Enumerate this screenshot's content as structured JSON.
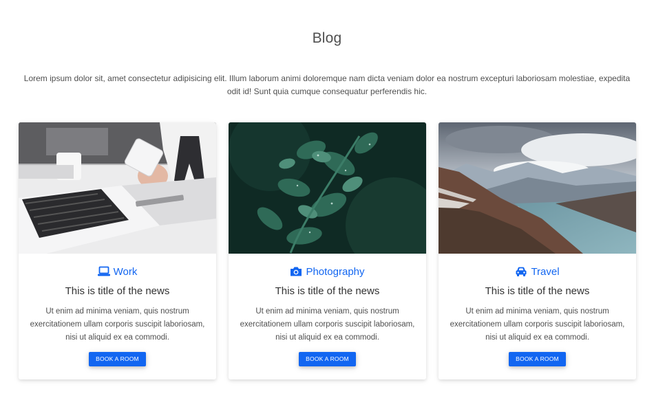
{
  "section": {
    "title": "Blog",
    "intro": "Lorem ipsum dolor sit, amet consectetur adipisicing elit. Illum laborum animi doloremque nam dicta veniam dolor ea nostrum excepturi laboriosam molestiae, expedita odit id! Sunt quia cumque consequatur perferendis hic."
  },
  "colors": {
    "accent": "#1266f1",
    "text": "#4f4f4f"
  },
  "cards": [
    {
      "image": "laptop-phone-desk-photo",
      "category_icon": "laptop-icon",
      "category": "Work",
      "title": "This is title of the news",
      "text": "Ut enim ad minima veniam, quis nostrum exercitationem ullam corporis suscipit laboriosam, nisi ut aliquid ex ea commodi.",
      "button": "Book a room"
    },
    {
      "image": "green-leaves-photo",
      "category_icon": "camera-icon",
      "category": "Photography",
      "title": "This is title of the news",
      "text": "Ut enim ad minima veniam, quis nostrum exercitationem ullam corporis suscipit laboriosam, nisi ut aliquid ex ea commodi.",
      "button": "Book a room"
    },
    {
      "image": "mountain-lake-photo",
      "category_icon": "car-icon",
      "category": "Travel",
      "title": "This is title of the news",
      "text": "Ut enim ad minima veniam, quis nostrum exercitationem ullam corporis suscipit laboriosam, nisi ut aliquid ex ea commodi.",
      "button": "Book a room"
    }
  ]
}
